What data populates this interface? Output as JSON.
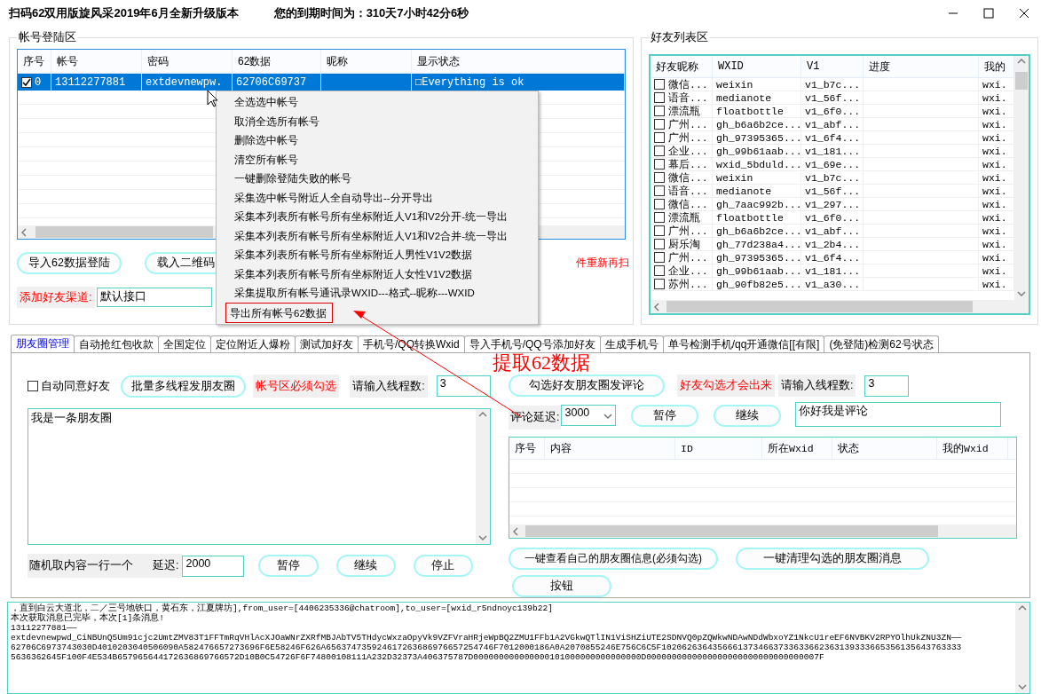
{
  "window": {
    "title": "扫码62双用版旋风采2019年6月全新升级版本",
    "expiry": "您的到期时间为：310天7小时42分6秒"
  },
  "account_panel": {
    "title": "帐号登陆区",
    "columns": [
      "序号",
      "帐号",
      "密码",
      "62数据",
      "昵称",
      "显示状态"
    ],
    "rows": [
      {
        "checked": true,
        "selected": true,
        "index": "0",
        "account": "13112277881",
        "password": "extdevnewpw.",
        "data62": "62706C69737",
        "status": "□Everything is ok"
      }
    ],
    "buttons": [
      "导入62数据登陆",
      "载入二维码"
    ],
    "notice": "件重新再扫",
    "channel_label": "添加好友渠道:",
    "channel_value": "默认接口"
  },
  "context_menu": {
    "items": [
      {
        "label": "全选选中帐号",
        "framed": false
      },
      {
        "label": "取消全选所有帐号",
        "framed": false
      },
      {
        "label": "删除选中帐号",
        "framed": false
      },
      {
        "label": "清空所有帐号",
        "framed": false
      },
      {
        "label": "一键删除登陆失败的帐号",
        "framed": false
      },
      {
        "label": "采集选中帐号附近人全自动导出--分开导出",
        "framed": false
      },
      {
        "label": "采集本列表所有帐号所有坐标附近人V1和V2分开-统一导出",
        "framed": false
      },
      {
        "label": "采集本列表所有帐号所有坐标附近人V1和V2合并-统一导出",
        "framed": false
      },
      {
        "label": "采集本列表所有帐号所有坐标附近人男性V1V2数据",
        "framed": false
      },
      {
        "label": "采集本列表所有帐号所有坐标附近人女性V1V2数据",
        "framed": false
      },
      {
        "label": "采集提取所有帐号通讯录WXID---格式--昵称---WXID",
        "framed": false
      },
      {
        "label": "导出所有帐号62数据",
        "framed": true
      }
    ]
  },
  "annotation": "提取62数据",
  "friend_panel": {
    "title": "好友列表区",
    "columns": [
      "好友昵称",
      "WXID",
      "V1",
      "进度",
      "我的"
    ],
    "rows": [
      {
        "checked": false,
        "cells": [
          "微信...",
          "weixin",
          "v1_b7c...",
          "wxi."
        ]
      },
      {
        "checked": false,
        "cells": [
          "语音...",
          "medianote",
          "v1_56f...",
          "wxi."
        ]
      },
      {
        "checked": false,
        "cells": [
          "漂流瓶",
          "floatbottle",
          "v1_6f0...",
          "wxi."
        ]
      },
      {
        "checked": false,
        "cells": [
          "广州...",
          "gh_b6a6b2ce...",
          "v1_abf...",
          "wxi."
        ]
      },
      {
        "checked": false,
        "cells": [
          "广州...",
          "gh_97395365...",
          "v1_6f4...",
          "wxi."
        ]
      },
      {
        "checked": false,
        "cells": [
          "企业...",
          "gh_99b61aab...",
          "v1_181...",
          "wxi."
        ]
      },
      {
        "checked": false,
        "cells": [
          "幕后...",
          "wxid_5bduld...",
          "v1_69e...",
          "wxi."
        ]
      },
      {
        "checked": false,
        "cells": [
          "微信...",
          "weixin",
          "v1_b7c...",
          "wxi."
        ]
      },
      {
        "checked": false,
        "cells": [
          "语音...",
          "medianote",
          "v1_56f...",
          "wxi."
        ]
      },
      {
        "checked": false,
        "cells": [
          "微信...",
          "gh_7aac992b...",
          "v1_297...",
          "wxi."
        ]
      },
      {
        "checked": false,
        "cells": [
          "漂流瓶",
          "floatbottle",
          "v1_6f0...",
          "wxi."
        ]
      },
      {
        "checked": false,
        "cells": [
          "广州...",
          "gh_b6a6b2ce...",
          "v1_abf...",
          "wxi."
        ]
      },
      {
        "checked": false,
        "cells": [
          "厨乐淘",
          "gh_77d238a4...",
          "v1_2b4...",
          "wxi."
        ]
      },
      {
        "checked": false,
        "cells": [
          "广州...",
          "gh_97395365...",
          "v1_6f4...",
          "wxi."
        ]
      },
      {
        "checked": false,
        "cells": [
          "企业...",
          "gh_99b61aab...",
          "v1_181...",
          "wxi."
        ]
      },
      {
        "checked": false,
        "cells": [
          "苏州...",
          "gh_90fb82e5...",
          "v1_a30...",
          "wxi."
        ]
      }
    ]
  },
  "tabs": [
    {
      "label": "朋友圈管理",
      "selected": true
    },
    {
      "label": "自动抢红包收款",
      "selected": false
    },
    {
      "label": "全国定位",
      "selected": false
    },
    {
      "label": "定位附近人爆粉",
      "selected": false
    },
    {
      "label": "测试加好友",
      "selected": false
    },
    {
      "label": "手机号/QQ转换Wxid",
      "selected": false
    },
    {
      "label": "导入手机号/QQ号添加好友",
      "selected": false
    },
    {
      "label": "生成手机号",
      "selected": false
    },
    {
      "label": "单号检测手机/qq开通微信[[有限]",
      "selected": false
    },
    {
      "label": "(免登陆)检测62号状态",
      "selected": false
    }
  ],
  "moments": {
    "auto_accept": {
      "label": "自动同意好友",
      "checked": false
    },
    "batch_button": "批量多线程发朋友圈",
    "warning": "帐号区必须勾选",
    "threads_label": "请输入线程数:",
    "threads_value": "3",
    "content": "我是一条朋友圈",
    "random_label": "随机取内容一行一个",
    "delay_label": "延迟:",
    "delay_value": "2000",
    "controls": [
      "暂停",
      "继续",
      "停止"
    ],
    "comment_button": "勾选好友朋友圈发评论",
    "comment_warning": "好友勾选才会出来",
    "comment_threads_label": "请输入线程数:",
    "comment_threads_value": "3",
    "comment_delay_label": "评论延迟:",
    "comment_delay_value": "3000",
    "comment_controls": [
      "暂停",
      "继续"
    ],
    "comment_text": "你好我是评论",
    "table_columns": [
      "序号",
      "内容",
      "ID",
      "所在Wxid",
      "状态",
      "我的Wxid"
    ],
    "bottom_buttons": [
      "一键查看自己的朋友圈信息(必须勾选)",
      "一键清理勾选的朋友圈消息"
    ],
    "extra_button": "按钮"
  },
  "log": [
    "，直到白云大道北，二／三号地铁口，黄石东，江夏牌坊],from_user=[4406235336@chatroom],to_user=[wxid_r5ndnoyc139b22]",
    "本次获取消息已完毕，本次[1]条消息!",
    "13112277881——",
    "extdevnewpwd_CiNBUnQ5Um91cjc2UmtZMV83T1FFTmRqVHlAcXJOaWNrZXRfMBJAbTV5THdycWxzaOpyVk9VZFVraHRjeWpBQ2ZMU1FFb1A2VGkwQTlIN1ViSHZiUTE2SDNVQ0pZQWkwNDAwNDdWbxoYZ1NkcU1reEF6NVBKV2RPYOlhUkZNU3ZN——",
    "62706C6973743030D4010203040506090A582476657273696F6E58246F626A656374735924617263686976657254746F7012000186A0A2070855246E756C6C5F10206263643566613734663733633662363139333665356135643763333",
    "5636362645F100F4E534B657965644172636869766572D10B0C54726F6F74800108111A232D32373A406375787D000000000000000101000000000000000D0000000000000000000000000000000007F"
  ]
}
